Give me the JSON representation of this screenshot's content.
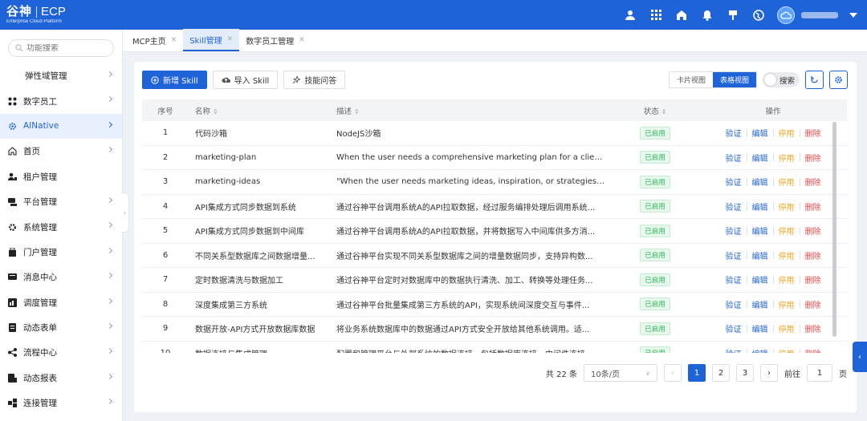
{
  "header": {
    "logo_cn": "谷神",
    "logo_ecp": "ECP",
    "logo_sub": "Enterprise Cloud Platform",
    "icons": [
      "user-icon",
      "apps-grid-icon",
      "home-icon",
      "bell-icon",
      "pin-icon",
      "globe-icon",
      "cloud-avatar-icon"
    ]
  },
  "sidebar": {
    "search_placeholder": "功能搜索",
    "items": [
      {
        "label": "弹性域管理",
        "icon": "",
        "sub": true
      },
      {
        "label": "数字员工",
        "icon": "nodes-icon"
      },
      {
        "label": "AINative",
        "icon": "gear-icon",
        "active": true
      },
      {
        "label": "首页",
        "icon": "home-icon"
      },
      {
        "label": "租户管理",
        "icon": "tenant-icon"
      },
      {
        "label": "平台管理",
        "icon": "platform-icon"
      },
      {
        "label": "系统管理",
        "icon": "settings-icon"
      },
      {
        "label": "门户管理",
        "icon": "portal-icon"
      },
      {
        "label": "消息中心",
        "icon": "message-icon"
      },
      {
        "label": "调度管理",
        "icon": "schedule-icon"
      },
      {
        "label": "动态表单",
        "icon": "form-icon"
      },
      {
        "label": "流程中心",
        "icon": "flow-icon"
      },
      {
        "label": "动态报表",
        "icon": "report-icon"
      },
      {
        "label": "连接管理",
        "icon": "link-icon"
      }
    ]
  },
  "tabs": [
    {
      "label": "MCP主页",
      "active": false
    },
    {
      "label": "Skill管理",
      "active": true
    },
    {
      "label": "数字员工管理",
      "active": false
    }
  ],
  "toolbar": {
    "add_label": "新增 Skill",
    "import_label": "导入 Skill",
    "qa_label": "技能问答",
    "card_view": "卡片视图",
    "table_view": "表格视图",
    "search_toggle": "搜索"
  },
  "table": {
    "headers": {
      "no": "序号",
      "name": "名称",
      "desc": "描述",
      "status": "状态",
      "ops": "操作"
    },
    "ops": {
      "verify": "验证",
      "edit": "编辑",
      "disable": "停用",
      "delete": "删除"
    },
    "rows": [
      {
        "no": "1",
        "name": "代码沙箱",
        "desc": "NodeJS沙箱",
        "status": "已启用"
      },
      {
        "no": "2",
        "name": "marketing-plan",
        "desc": "When the user needs a comprehensive marketing plan for a client, a c...",
        "status": "已启用"
      },
      {
        "no": "3",
        "name": "marketing-ideas",
        "desc": "\"When the user needs marketing ideas, inspiration, or strategies for th...",
        "status": "已启用"
      },
      {
        "no": "4",
        "name": "API集成方式同步数据到系统",
        "desc": "通过谷神平台调用系统A的API拉取数据，经过服务编排处理后调用系统...",
        "status": "已启用"
      },
      {
        "no": "5",
        "name": "API集成方式同步数据到中间库",
        "desc": "通过谷神平台调用系统A的API拉取数据，并将数据写入中间库供多方消...",
        "status": "已启用"
      },
      {
        "no": "6",
        "name": "不同关系型数据库之间数据增量...",
        "desc": "通过谷神平台实现不同关系型数据库之间的增量数据同步，支持异构数...",
        "status": "已启用"
      },
      {
        "no": "7",
        "name": "定时数据清洗与数据加工",
        "desc": "通过谷神平台定时对数据库中的数据执行清洗、加工、转换等处理任务...",
        "status": "已启用"
      },
      {
        "no": "8",
        "name": "深度集成第三方系统",
        "desc": "通过谷神平台批量集成第三方系统的API，实现系统间深度交互与事件...",
        "status": "已启用"
      },
      {
        "no": "9",
        "name": "数据开放-API方式开放数据库数据",
        "desc": "将业务系统数据库中的数据通过API方式安全开放给其他系统调用。适...",
        "status": "已启用"
      },
      {
        "no": "10",
        "name": "数据连接与集成管理",
        "desc": "配置和管理平台与外部系统的数据连接，包括数据库连接、中间件连接...",
        "status": "已启用"
      }
    ]
  },
  "pager": {
    "total": "共 22 条",
    "size": "10条/页",
    "pages": [
      "1",
      "2",
      "3"
    ],
    "current": "1",
    "goto_label": "前往",
    "goto_value": "1",
    "page_suffix": "页"
  }
}
